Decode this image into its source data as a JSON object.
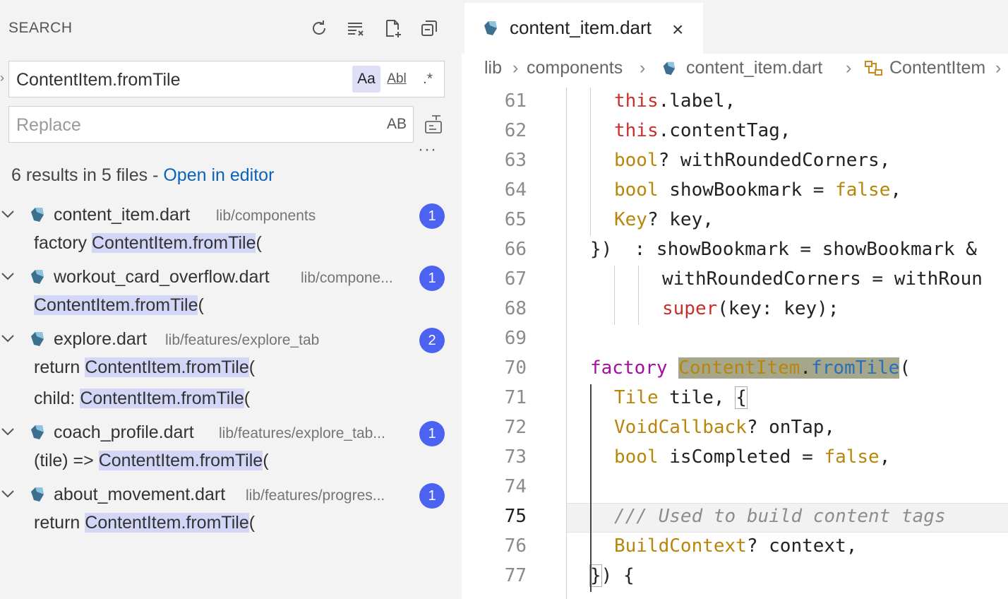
{
  "sidebar": {
    "title": "SEARCH",
    "find_value": "ContentItem.fromTile",
    "options": {
      "match_case": "Aa",
      "whole_word": "Abl",
      "regex": ".*"
    },
    "replace_placeholder": "Replace",
    "preserve_case": "AB",
    "more": "···",
    "summary_text": "6 results in 5 files - ",
    "open_in_editor": "Open in editor",
    "files": [
      {
        "name": "content_item.dart",
        "path": "lib/components",
        "count": "1",
        "matches": [
          {
            "before": "factory ",
            "match": "ContentItem.fromTile",
            "after": "("
          }
        ]
      },
      {
        "name": "workout_card_overflow.dart",
        "path": "lib/compone...",
        "count": "1",
        "matches": [
          {
            "before": "",
            "match": "ContentItem.fromTile",
            "after": "("
          }
        ]
      },
      {
        "name": "explore.dart",
        "path": "lib/features/explore_tab",
        "count": "2",
        "matches": [
          {
            "before": "return ",
            "match": "ContentItem.fromTile",
            "after": "("
          },
          {
            "before": "child: ",
            "match": "ContentItem.fromTile",
            "after": "("
          }
        ]
      },
      {
        "name": "coach_profile.dart",
        "path": "lib/features/explore_tab...",
        "count": "1",
        "matches": [
          {
            "before": "(tile) => ",
            "match": "ContentItem.fromTile",
            "after": "("
          }
        ]
      },
      {
        "name": "about_movement.dart",
        "path": "lib/features/progres...",
        "count": "1",
        "matches": [
          {
            "before": "return ",
            "match": "ContentItem.fromTile",
            "after": "("
          }
        ]
      }
    ]
  },
  "editor": {
    "tab_title": "content_item.dart",
    "tab_close": "×",
    "breadcrumb": [
      "lib",
      "components",
      "content_item.dart",
      "ContentItem"
    ],
    "current_line": "75",
    "lines": [
      {
        "n": "61",
        "segs": [
          [
            "kw",
            "this"
          ],
          [
            "",
            "."
          ],
          [
            "",
            "label,"
          ]
        ]
      },
      {
        "n": "62",
        "segs": [
          [
            "kw",
            "this"
          ],
          [
            "",
            ".contentTag,"
          ]
        ]
      },
      {
        "n": "63",
        "segs": [
          [
            "ty",
            "bool"
          ],
          [
            "",
            "? withRoundedCorners,"
          ]
        ]
      },
      {
        "n": "64",
        "segs": [
          [
            "ty",
            "bool"
          ],
          [
            "",
            " showBookmark = "
          ],
          [
            "ty",
            "false"
          ],
          [
            "",
            ","
          ]
        ]
      },
      {
        "n": "65",
        "segs": [
          [
            "ty",
            "Key"
          ],
          [
            "",
            "? key,"
          ]
        ]
      },
      {
        "n": "66",
        "segs": [
          [
            "",
            "})  : showBookmark = showBookmark &"
          ]
        ]
      },
      {
        "n": "67",
        "segs": [
          [
            "",
            "withRoundedCorners = withRoun"
          ]
        ]
      },
      {
        "n": "68",
        "segs": [
          [
            "kw",
            "super"
          ],
          [
            "",
            "(key: key);"
          ]
        ]
      },
      {
        "n": "69",
        "segs": []
      },
      {
        "n": "70",
        "segs": [
          [
            "kw2",
            "factory"
          ],
          [
            "",
            " "
          ],
          [
            "ty sel",
            "ContentItem"
          ],
          [
            "sel",
            "."
          ],
          [
            "fn sel",
            "fromTile"
          ],
          [
            "",
            "("
          ]
        ]
      },
      {
        "n": "71",
        "segs": [
          [
            "ty",
            "Tile"
          ],
          [
            "",
            " tile, "
          ],
          [
            "bracket",
            "{"
          ]
        ]
      },
      {
        "n": "72",
        "segs": [
          [
            "ty",
            "VoidCallback"
          ],
          [
            "",
            "? onTap,"
          ]
        ]
      },
      {
        "n": "73",
        "segs": [
          [
            "ty",
            "bool"
          ],
          [
            "",
            " isCompleted = "
          ],
          [
            "ty",
            "false"
          ],
          [
            "",
            ","
          ]
        ]
      },
      {
        "n": "74",
        "segs": []
      },
      {
        "n": "75",
        "segs": [
          [
            "cm",
            "/// Used to build content tags"
          ]
        ]
      },
      {
        "n": "76",
        "segs": [
          [
            "ty",
            "BuildContext"
          ],
          [
            "",
            "? context,"
          ]
        ]
      },
      {
        "n": "77",
        "segs": [
          [
            "bracket",
            "}"
          ],
          [
            "",
            ") {"
          ]
        ]
      }
    ]
  },
  "colors": {
    "badge": "#4b63f0",
    "link": "#0b63b8",
    "match_highlight": "#d3d6f6",
    "selection": "#a6a68a"
  }
}
